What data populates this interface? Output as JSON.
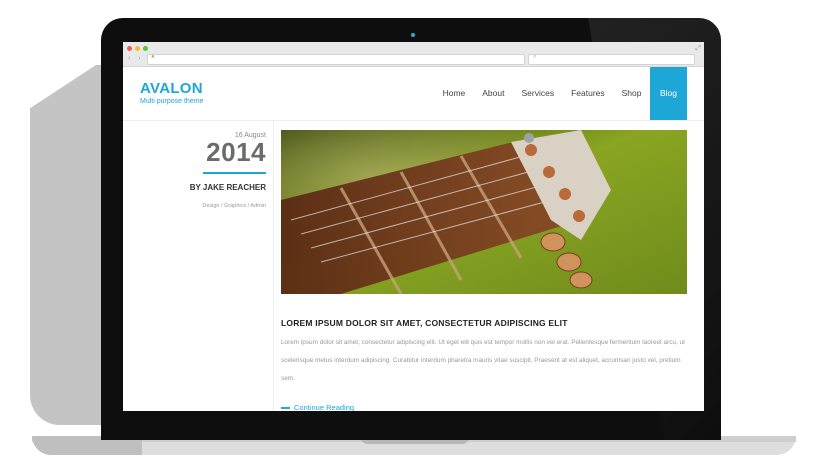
{
  "site": {
    "logo": "AVALON",
    "tagline": "Multi purpose theme"
  },
  "nav": {
    "items": [
      "Home",
      "About",
      "Services",
      "Features",
      "Shop",
      "Blog"
    ],
    "active": "Blog"
  },
  "post": {
    "date": "16 August",
    "year": "2014",
    "author": "BY JAKE REACHER",
    "tags": [
      "Design",
      "Graphics",
      "Admin"
    ],
    "tag_separator": "/",
    "image": "guitar-headstock-photo",
    "title": "LOREM IPSUM DOLOR SIT AMET, CONSECTETUR ADIPISCING ELIT",
    "body": "Lorem ipsum dolor sit amet, consectetur adipiscing elit. Ut eget elit quis est tempor mollis non vel erat. Pellentesque fermentum laoreet arcu, ut scelerisque metus interdum adipiscing. Curabitur interdum pharetra mauris vitae suscipit. Praesent at est aliquet, accumsan justo vel, pretium sem.",
    "read_more": "Continue Reading"
  },
  "colors": {
    "accent": "#1ea7d6",
    "bezel": "#0e0e0e",
    "body_text": "#999999"
  }
}
